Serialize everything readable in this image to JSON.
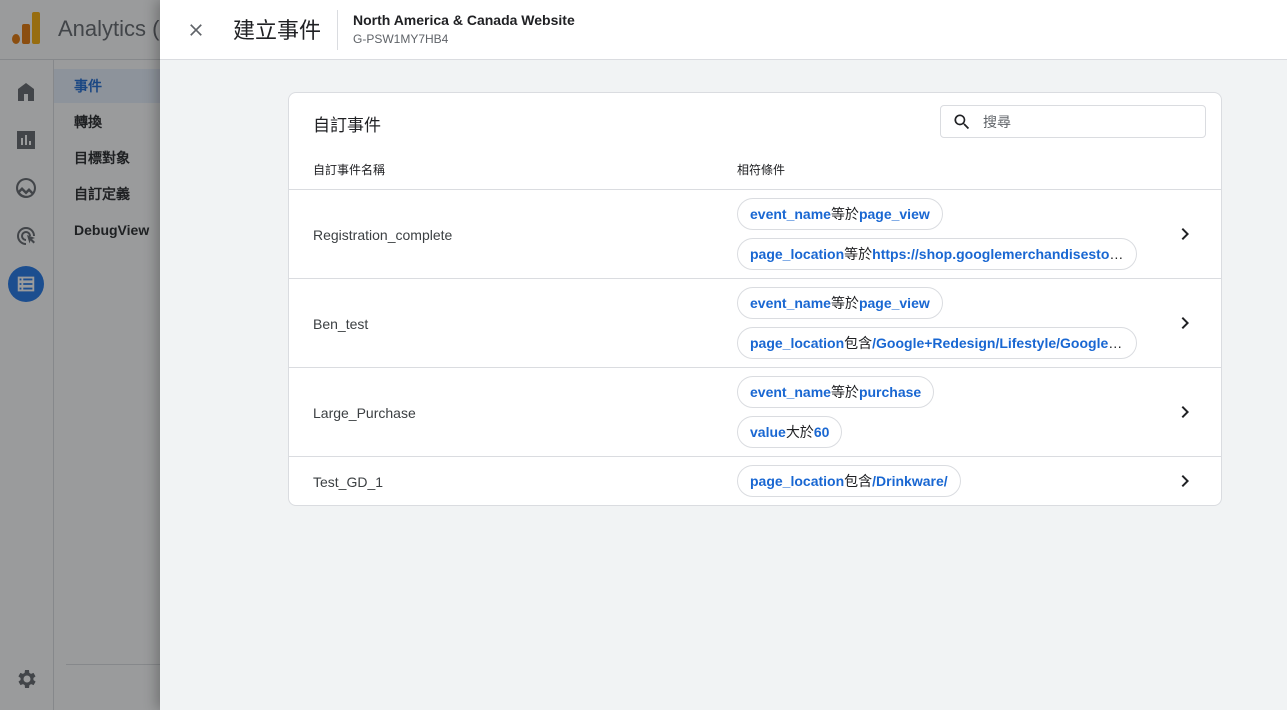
{
  "app": {
    "title": "Analytics (",
    "nav_items": [
      {
        "label": "事件",
        "active": true
      },
      {
        "label": "轉換",
        "active": false
      },
      {
        "label": "目標對象",
        "active": false
      },
      {
        "label": "自訂定義",
        "active": false
      },
      {
        "label": "DebugView",
        "active": false
      }
    ],
    "rail_icons": [
      "home-icon",
      "reports-icon",
      "explore-icon",
      "advertising-icon",
      "configure-icon",
      "settings-icon"
    ]
  },
  "panel": {
    "title": "建立事件",
    "property_name": "North America & Canada Website",
    "property_id": "G-PSW1MY7HB4"
  },
  "card": {
    "title": "自訂事件",
    "search_placeholder": "搜尋",
    "columns": {
      "name": "自訂事件名稱",
      "conditions": "相符條件"
    },
    "rows": [
      {
        "name": "Registration_complete",
        "conditions": [
          {
            "param": "event_name",
            "op": "等於",
            "value": "page_view"
          },
          {
            "param": "page_location",
            "op": "等於",
            "value": "https://shop.googlemerchandisestore…"
          }
        ]
      },
      {
        "name": "Ben_test",
        "conditions": [
          {
            "param": "event_name",
            "op": "等於",
            "value": "page_view"
          },
          {
            "param": "page_location",
            "op": "包含",
            "value": "/Google+Redesign/Lifestyle/Google+…"
          }
        ]
      },
      {
        "name": "Large_Purchase",
        "conditions": [
          {
            "param": "event_name",
            "op": "等於",
            "value": "purchase"
          },
          {
            "param": "value",
            "op": "大於",
            "value": "60"
          }
        ]
      },
      {
        "name": "Test_GD_1",
        "conditions": [
          {
            "param": "page_location",
            "op": "包含",
            "value": "/Drinkware/"
          }
        ]
      }
    ]
  },
  "colors": {
    "accent": "#1a73e8",
    "link": "#1967d2",
    "border": "#dadce0"
  }
}
